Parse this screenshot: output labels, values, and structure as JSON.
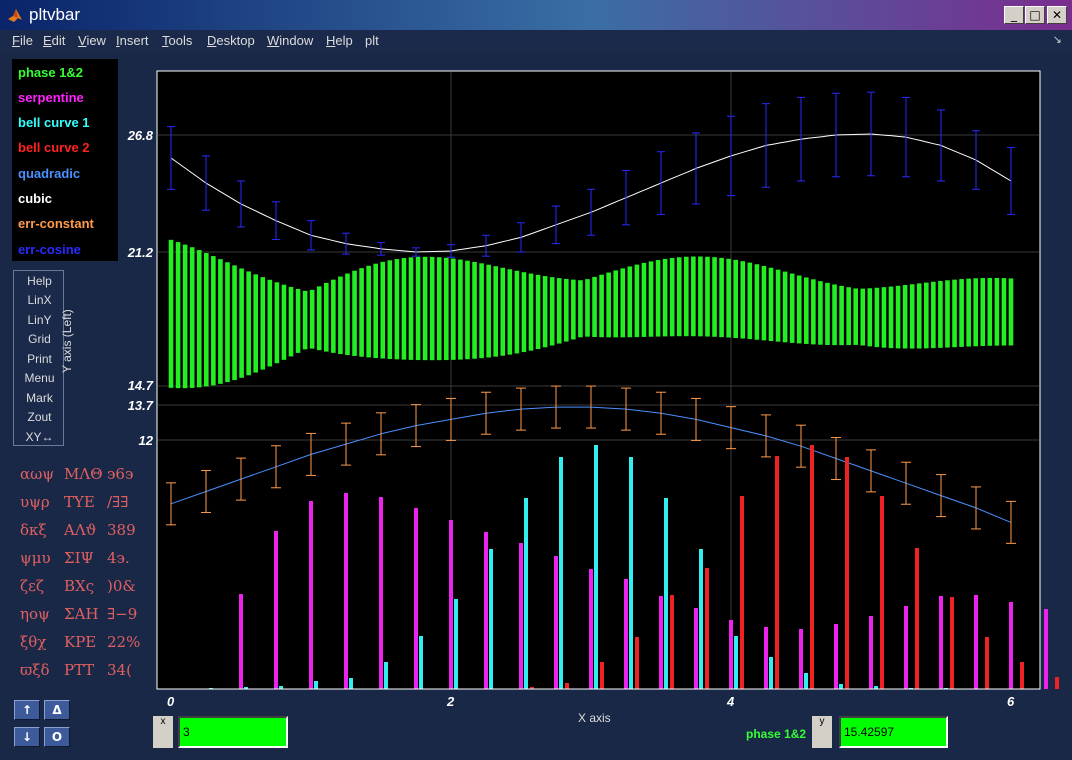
{
  "window": {
    "title": "pltvbar",
    "minimize": "_",
    "maximize": "□",
    "close": "✕"
  },
  "menu": [
    {
      "label": "File",
      "u": "F",
      "rest": "ile"
    },
    {
      "label": "Edit",
      "u": "E",
      "rest": "dit"
    },
    {
      "label": "View",
      "u": "V",
      "rest": "iew"
    },
    {
      "label": "Insert",
      "u": "I",
      "rest": "nsert"
    },
    {
      "label": "Tools",
      "u": "T",
      "rest": "ools"
    },
    {
      "label": "Desktop",
      "u": "D",
      "rest": "esktop"
    },
    {
      "label": "Window",
      "u": "W",
      "rest": "indow"
    },
    {
      "label": "Help",
      "u": "H",
      "rest": "elp"
    },
    {
      "label": "plt",
      "u": "",
      "rest": "plt"
    }
  ],
  "dock_arrow": "↘",
  "legend": [
    {
      "label": "phase 1&2",
      "color": "#33ff33"
    },
    {
      "label": "serpentine",
      "color": "#ff22ff"
    },
    {
      "label": "bell curve 1",
      "color": "#33ffff"
    },
    {
      "label": "bell curve 2",
      "color": "#ff2222"
    },
    {
      "label": "quadradic",
      "color": "#4a90ff"
    },
    {
      "label": "cubic",
      "color": "#ffffff"
    },
    {
      "label": "err-constant",
      "color": "#ff9a4a"
    },
    {
      "label": "err-cosine",
      "color": "#2020ff"
    }
  ],
  "side_menu": [
    "Help",
    "LinX",
    "LinY",
    "Grid",
    "Print",
    "Menu",
    "Mark",
    "Zout",
    "XY↔"
  ],
  "greek_table": [
    [
      "αωψ",
      "ΜΛΘ",
      "϶6϶"
    ],
    [
      "υψρ",
      "ΤΥΕ",
      "/∃∃"
    ],
    [
      "δκξ",
      "ΑΛϑ",
      "389"
    ],
    [
      "ψμυ",
      "ΣΙΨ",
      "4϶."
    ],
    [
      "ζεζ",
      "ΒΧς",
      ")0&"
    ],
    [
      "ηοψ",
      "ΣΑΗ",
      "∃−9"
    ],
    [
      "ξθχ",
      "ΚΡΕ",
      "22%"
    ],
    [
      "ϖξδ",
      "ΡΤΤ",
      "34("
    ]
  ],
  "nav_buttons": [
    "↑",
    "Δ",
    "↓",
    "O"
  ],
  "axes": {
    "ylabel": "Y axis (Left)",
    "xlabel": "X axis",
    "yticks": [
      "26.8",
      "21.2",
      "14.7",
      "13.7",
      "12"
    ],
    "xticks": [
      "0",
      "2",
      "4",
      "6"
    ]
  },
  "cursor": {
    "x_tag": "x",
    "x_value": "3",
    "y_tag": "y",
    "trace_name": "phase 1&2",
    "y_value": "15.42597"
  },
  "colors": {
    "phase": "#22ee22",
    "serpentine": "#ee22ee",
    "bell1": "#33eeee",
    "bell2": "#ee2222",
    "quadradic": "#4a90ff",
    "cubic": "#ffffff",
    "errConstant": "#ff9a4a",
    "errCosine": "#2a2aff"
  },
  "chart_data": {
    "type": "bar",
    "xlabel": "X axis",
    "ylabel": "Y axis (Left)",
    "xlim": [
      0,
      6
    ],
    "series": [
      {
        "name": "cubic",
        "kind": "line",
        "x": [
          0,
          0.25,
          0.5,
          0.75,
          1,
          1.25,
          1.5,
          1.75,
          2,
          2.25,
          2.5,
          2.75,
          3,
          3.25,
          3.5,
          3.75,
          4,
          4.25,
          4.5,
          4.75,
          5,
          5.25,
          5.5,
          5.75,
          6
        ],
        "y": [
          25.7,
          24.5,
          23.5,
          22.7,
          22.0,
          21.6,
          21.35,
          21.2,
          21.25,
          21.5,
          21.9,
          22.5,
          23.1,
          23.8,
          24.5,
          25.2,
          25.8,
          26.3,
          26.6,
          26.8,
          26.85,
          26.7,
          26.3,
          25.6,
          24.6
        ],
        "err": [
          1.5,
          1.3,
          1.1,
          0.9,
          0.7,
          0.5,
          0.3,
          0.2,
          0.3,
          0.5,
          0.7,
          0.9,
          1.1,
          1.3,
          1.5,
          1.7,
          1.9,
          2.0,
          2.0,
          2.0,
          2.0,
          1.9,
          1.7,
          1.4,
          1.6
        ]
      },
      {
        "name": "err-constant / quadradic",
        "kind": "line",
        "x": [
          0,
          0.25,
          0.5,
          0.75,
          1,
          1.25,
          1.5,
          1.75,
          2,
          2.25,
          2.5,
          2.75,
          3,
          3.25,
          3.5,
          3.75,
          4,
          4.25,
          4.5,
          4.75,
          5,
          5.25,
          5.5,
          5.75,
          6
        ],
        "y": [
          8.9,
          9.5,
          10.1,
          10.7,
          11.3,
          11.8,
          12.3,
          12.7,
          13.0,
          13.3,
          13.5,
          13.6,
          13.6,
          13.5,
          13.3,
          13.0,
          12.6,
          12.2,
          11.7,
          11.1,
          10.5,
          9.9,
          9.3,
          8.7,
          8.0
        ],
        "err": 0.85
      },
      {
        "name": "phase 1&2",
        "kind": "bar",
        "ylim": [
          14.7,
          21.2
        ]
      },
      {
        "name": "serpentine",
        "kind": "bar"
      },
      {
        "name": "bell curve 1",
        "kind": "bar"
      },
      {
        "name": "bell curve 2",
        "kind": "bar"
      }
    ]
  }
}
